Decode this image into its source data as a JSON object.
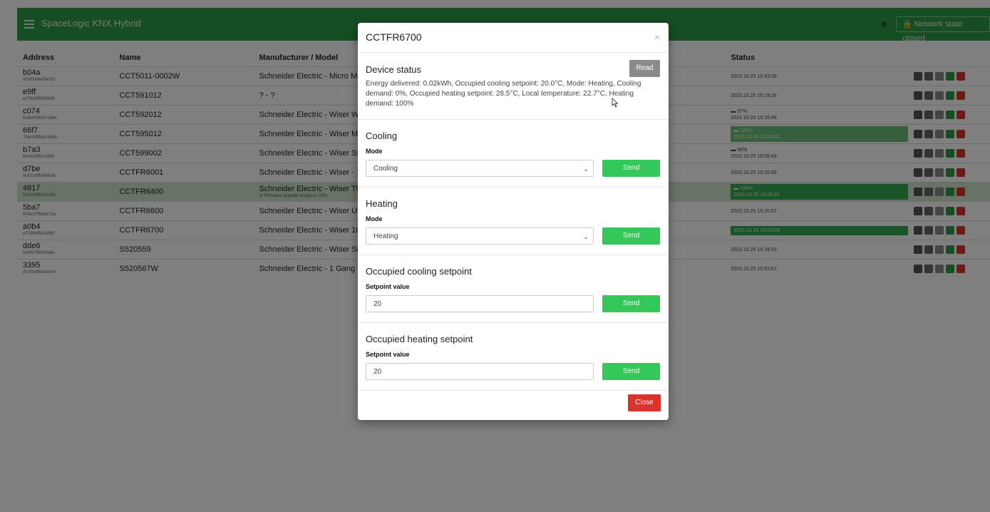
{
  "app": {
    "title": "SpaceLogic KNX Hybrid",
    "network_state": "Network state: closed"
  },
  "table": {
    "headers": [
      "Address",
      "Name",
      "Manufacturer / Model",
      "Status"
    ],
    "rows": [
      {
        "address": "b04a",
        "id": "00395effed341bf",
        "name": "CCT5011-0002W",
        "model": "Schneider Electric - Micro Mo",
        "status": "2023.10.25 15:43:08"
      },
      {
        "address": "e9ff",
        "id": "e0798dfffef59bf9",
        "name": "CCT591012",
        "model": "? - ?",
        "status": "2023.10.25 16:19:16"
      },
      {
        "address": "c074",
        "id": "8c8e95fffe57c9b4",
        "name": "CCT592012",
        "model": "Schneider Electric - Wiser Wa",
        "battery": "97%",
        "status": "2023.10.25 16:16:48"
      },
      {
        "address": "66f7",
        "id": "70ac08fffea768ab",
        "name": "CCT595012",
        "model": "Schneider Electric - Wiser Mo",
        "battery": "100%",
        "status": "2023.10.25 16:20:32"
      },
      {
        "address": "b7a3",
        "id": "84cd15fffec3f8cf",
        "name": "CCT599002",
        "model": "Schneider Electric - Wiser Sm",
        "battery": "96%",
        "status": "2023.10.25 16:06:43"
      },
      {
        "address": "d7be",
        "id": "8c4314fffe98926c",
        "name": "CCTFR6001",
        "model": "Schneider Electric - Wiser - 1",
        "status": "2023.10.25 16:15:59"
      },
      {
        "address": "4617",
        "id": "5425b4fffe00e3fb",
        "name": "CCTFR6400",
        "model": "Schneider Electric - Wiser Th",
        "firmware": "Firmware upgrade progress: 24%",
        "battery": "100%",
        "status": "2023.10.25 16:20:31"
      },
      {
        "address": "5ba7",
        "id": "806bd7fffedfe72e",
        "name": "CCTFR6600",
        "model": "Schneider Electric - Wiser Un",
        "status": "2023.10.25 16:20:07"
      },
      {
        "address": "a0b4",
        "id": "e0798dfffe35ff89",
        "name": "CCTFR6700",
        "model": "Schneider Electric - Wiser 16",
        "status": "2023.10.25 16:20:09"
      },
      {
        "address": "dde6",
        "id": "540f57fffe04fa6e",
        "name": "S520559",
        "model": "Schneider Electric - Wiser Sin",
        "status": "2023.10.25 16:18:33"
      },
      {
        "address": "3395",
        "id": "d0cf5efffe0dacb4",
        "name": "S520567W",
        "model": "Schneider Electric - 1 Gang B",
        "status": "2023.10.25 15:53:57"
      }
    ]
  },
  "modal": {
    "title": "CCTFR6700",
    "close_x": "×",
    "status": {
      "title": "Device status",
      "read_label": "Read",
      "text": "Energy delivered: 0.02kWh, Occupied cooling setpoint: 20.0°C, Mode: Heating, Cooling demand: 0%, Occupied heating setpoint: 28.5°C, Local temperature: 22.7°C, Heating demand: 100%"
    },
    "cooling": {
      "title": "Cooling",
      "label": "Mode",
      "value": "Cooling",
      "send": "Send"
    },
    "heating": {
      "title": "Heating",
      "label": "Mode",
      "value": "Heating",
      "send": "Send"
    },
    "cool_setpoint": {
      "title": "Occupied cooling setpoint",
      "label": "Setpoint value",
      "value": "20",
      "send": "Send"
    },
    "heat_setpoint": {
      "title": "Occupied heating setpoint",
      "label": "Setpoint value",
      "value": "20",
      "send": "Send"
    },
    "close_label": "Close"
  }
}
